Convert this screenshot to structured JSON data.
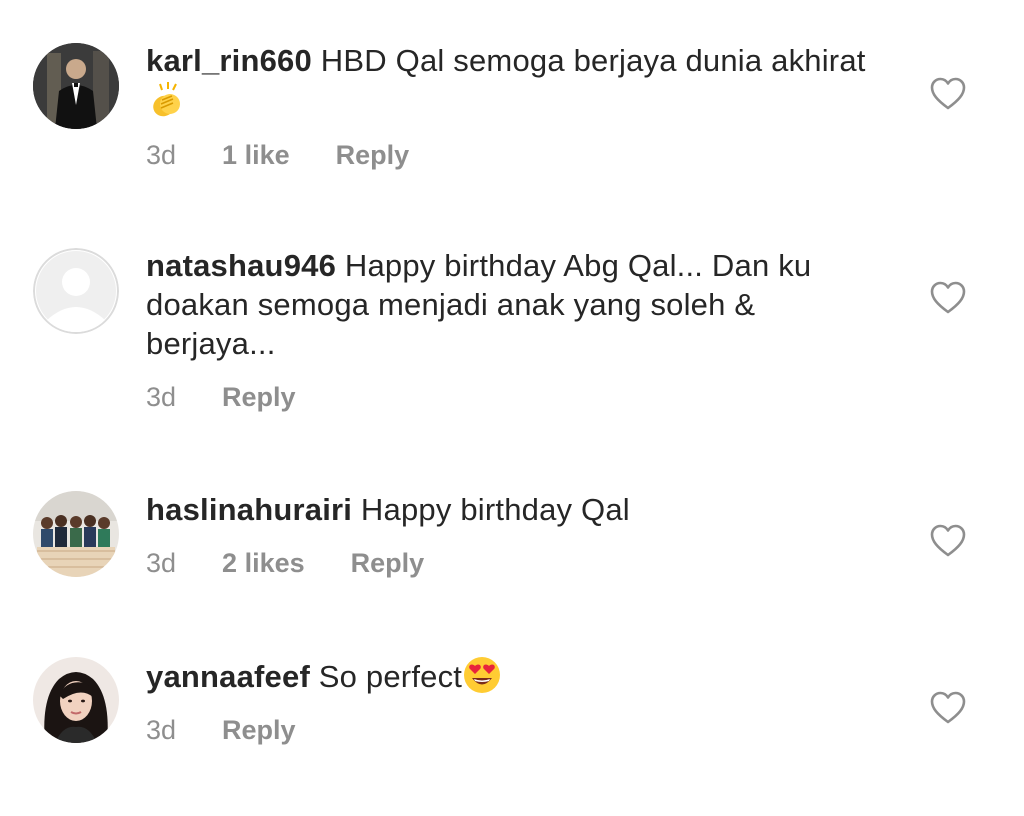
{
  "comments": [
    {
      "username": "karl_rin660",
      "text": "HBD Qal semoga berjaya dunia akhirat",
      "emoji": "clapping-hands",
      "time": "3d",
      "likes": "1 like",
      "reply": "Reply",
      "avatar_icon": "profile-photo-man-in-suit"
    },
    {
      "username": "natashau946",
      "text": "Happy birthday Abg Qal... Dan ku doakan semoga menjadi anak yang soleh & berjaya...",
      "time": "3d",
      "reply": "Reply",
      "avatar_icon": "default-avatar"
    },
    {
      "username": "haslinahurairi",
      "text": "Happy birthday Qal",
      "time": "3d",
      "likes": "2 likes",
      "reply": "Reply",
      "avatar_icon": "profile-photo-group"
    },
    {
      "username": "yannaafeef",
      "text": "So perfect",
      "emoji": "heart-eyes",
      "time": "3d",
      "reply": "Reply",
      "avatar_icon": "profile-photo-woman"
    }
  ],
  "colors": {
    "text": "#262626",
    "meta": "#8e8e8e",
    "background": "#ffffff"
  }
}
